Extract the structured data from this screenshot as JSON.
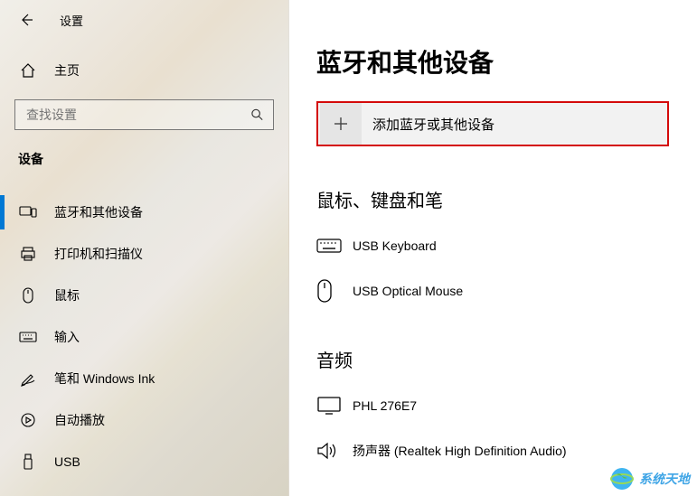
{
  "titlebar": {
    "app_title": "设置"
  },
  "home": {
    "label": "主页"
  },
  "search": {
    "placeholder": "查找设置"
  },
  "section_label": "设备",
  "nav": {
    "items": [
      {
        "label": "蓝牙和其他设备"
      },
      {
        "label": "打印机和扫描仪"
      },
      {
        "label": "鼠标"
      },
      {
        "label": "输入"
      },
      {
        "label": "笔和 Windows Ink"
      },
      {
        "label": "自动播放"
      },
      {
        "label": "USB"
      }
    ]
  },
  "page": {
    "title": "蓝牙和其他设备",
    "add_device_label": "添加蓝牙或其他设备"
  },
  "section_mouse_keyboard_pen": {
    "heading": "鼠标、键盘和笔",
    "items": [
      {
        "label": "USB Keyboard"
      },
      {
        "label": "USB Optical Mouse"
      }
    ]
  },
  "section_audio": {
    "heading": "音频",
    "items": [
      {
        "label": "PHL 276E7"
      },
      {
        "label": "扬声器 (Realtek High Definition Audio)"
      }
    ]
  },
  "watermark": {
    "text": "系统天地"
  }
}
